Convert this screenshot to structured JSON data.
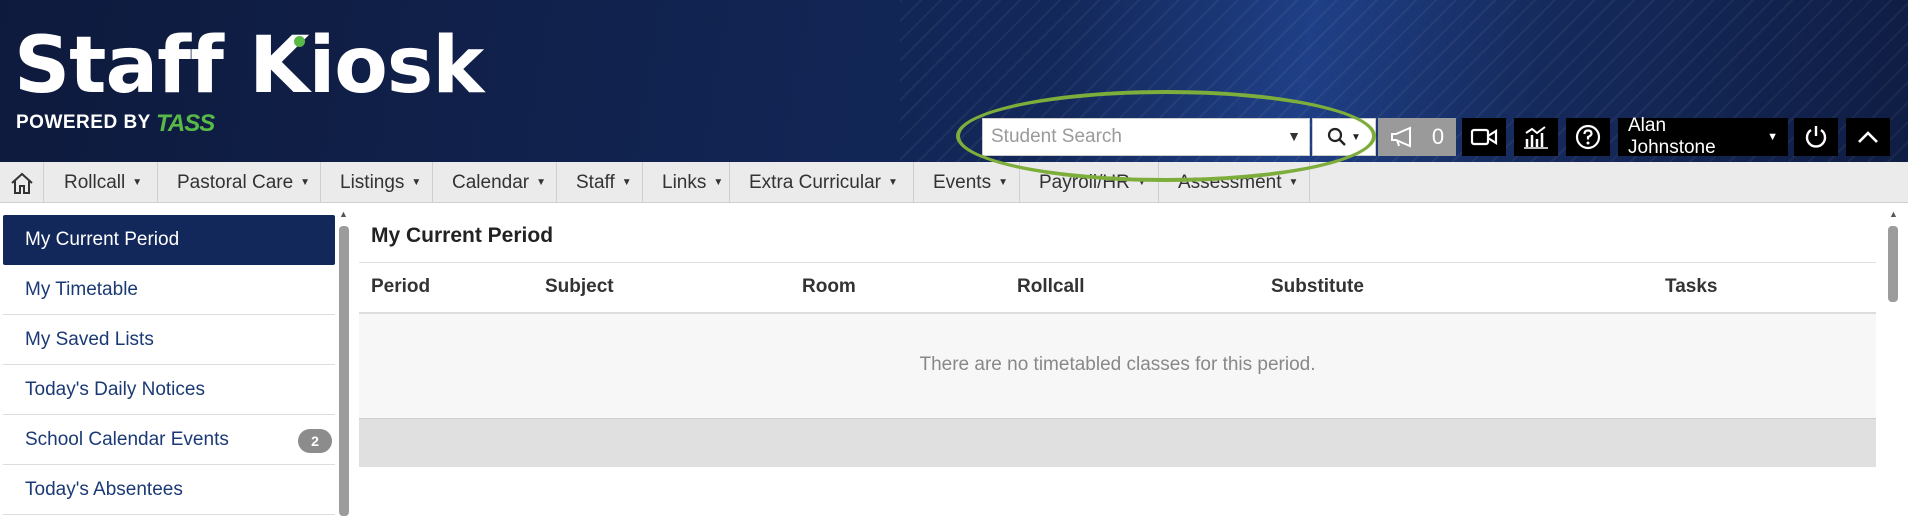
{
  "header": {
    "logo_title": "Staff Kiosk",
    "logo_powered": "POWERED BY",
    "logo_brand": "TASS",
    "search_placeholder": "Student Search",
    "notice_count": "0",
    "user_name": "Alan Johnstone"
  },
  "nav": {
    "home_icon": "home-icon",
    "items": [
      {
        "label": "Rollcall"
      },
      {
        "label": "Pastoral Care"
      },
      {
        "label": "Listings"
      },
      {
        "label": "Calendar"
      },
      {
        "label": "Staff"
      },
      {
        "label": "Links"
      },
      {
        "label": "Extra Curricular"
      },
      {
        "label": "Events"
      },
      {
        "label": "Payroll/HR"
      },
      {
        "label": "Assessment"
      }
    ]
  },
  "sidebar": {
    "items": [
      {
        "label": "My Current Period",
        "active": true
      },
      {
        "label": "My Timetable"
      },
      {
        "label": "My Saved Lists"
      },
      {
        "label": "Today's Daily Notices"
      },
      {
        "label": "School Calendar Events",
        "badge": "2"
      },
      {
        "label": "Today's Absentees"
      }
    ]
  },
  "main": {
    "title": "My Current Period",
    "columns": [
      "Period",
      "Subject",
      "Room",
      "Rollcall",
      "Substitute",
      "Tasks"
    ],
    "empty_message": "There are no timetabled classes for this period."
  },
  "colors": {
    "header_navy": "#13285a",
    "brand_green": "#58b947",
    "highlight_green": "#7dad3a",
    "link_blue": "#1b3a75"
  }
}
